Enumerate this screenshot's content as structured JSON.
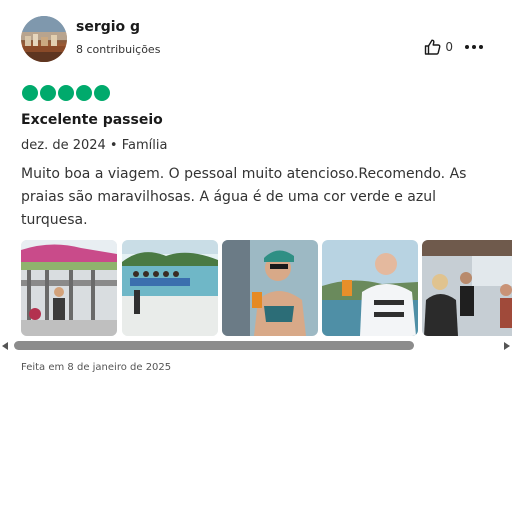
{
  "review": {
    "user_name": "sergio g",
    "contributions": "8 contribuições",
    "like_count": "0",
    "rating": 5,
    "title": "Excelente passeio",
    "meta": "dez. de 2024 • Família",
    "body": "Muito boa a viagem. O pessoal muito atencioso.Recomendo. As praias são maravilhosas. A água é de uma cor verde e azul turquesa.",
    "written_date": "Feita em 8 de janeiro de 2025"
  },
  "icons": {
    "like": "thumbs-up-icon",
    "more": "more-options-icon",
    "rating": "rating-bubble-icon"
  },
  "colors": {
    "rating_green": "#00aa6c",
    "text_dark": "#1a1a1a"
  },
  "photos": [
    {
      "name": "photo-boat-deck"
    },
    {
      "name": "photo-beach-crowd"
    },
    {
      "name": "photo-woman-drink"
    },
    {
      "name": "photo-man-drink"
    },
    {
      "name": "photo-boat-passengers"
    }
  ]
}
